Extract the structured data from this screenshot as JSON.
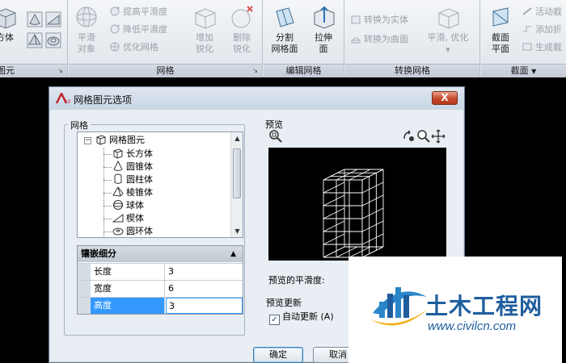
{
  "ribbon": {
    "panels": [
      {
        "title": "图元",
        "has_arrow": true
      },
      {
        "title": "网格",
        "has_arrow": true
      },
      {
        "title": "编辑网格",
        "has_arrow": false
      },
      {
        "title": "转换网格",
        "has_arrow": false
      },
      {
        "title": "截面",
        "has_arrow": true
      }
    ],
    "primitive": {
      "box_label": "方体"
    },
    "mesh": {
      "smooth_object": {
        "line1": "平滑",
        "line2": "对象"
      },
      "increase_smoothness": "提高平滑度",
      "decrease_smoothness": "降低平滑度",
      "refine_mesh": "优化网格",
      "add_crease": {
        "line1": "增加",
        "line2": "锐化"
      },
      "remove_crease": {
        "line1": "删除",
        "line2": "锐化"
      }
    },
    "edit_mesh": {
      "split_face": {
        "line1": "分割",
        "line2": "网格面"
      },
      "extrude_face": {
        "line1": "拉伸",
        "line2": "面"
      }
    },
    "convert_mesh": {
      "to_solid": "转换为实体",
      "to_surface": "转换为曲面",
      "smooth_optimized": "平滑, 优化"
    },
    "section": {
      "section_plane": {
        "line1": "截面",
        "line2": "平面"
      },
      "live_section": "活动截",
      "add_jog": "添加折",
      "generate_section": "生成截"
    }
  },
  "dialog": {
    "title": "网格图元选项",
    "close_label": "X",
    "mesh_group_label": "网格",
    "tree": {
      "root": "网格图元",
      "items": [
        "长方体",
        "圆锥体",
        "圆柱体",
        "棱锥体",
        "球体",
        "楔体",
        "圆环体"
      ]
    },
    "tessellation": {
      "header": "镶嵌细分",
      "rows": [
        {
          "name": "长度",
          "value": "3"
        },
        {
          "name": "宽度",
          "value": "6"
        },
        {
          "name": "高度",
          "value": "3"
        }
      ]
    },
    "preview_group_label": "预览",
    "smoothness_label": "预览的平滑度:",
    "preview_update_label": "预览更新",
    "auto_update_label": "自动更新 (A)",
    "auto_update_checked": true,
    "ok_label": "确定",
    "cancel_label": "取消"
  },
  "watermark": {
    "title": "土木工程网",
    "url": "www.civilcn.com"
  },
  "colors": {
    "dialog_bg": "#e9eef4",
    "selection": "#3399ff",
    "watermark_blue": "#1f5e9e"
  }
}
